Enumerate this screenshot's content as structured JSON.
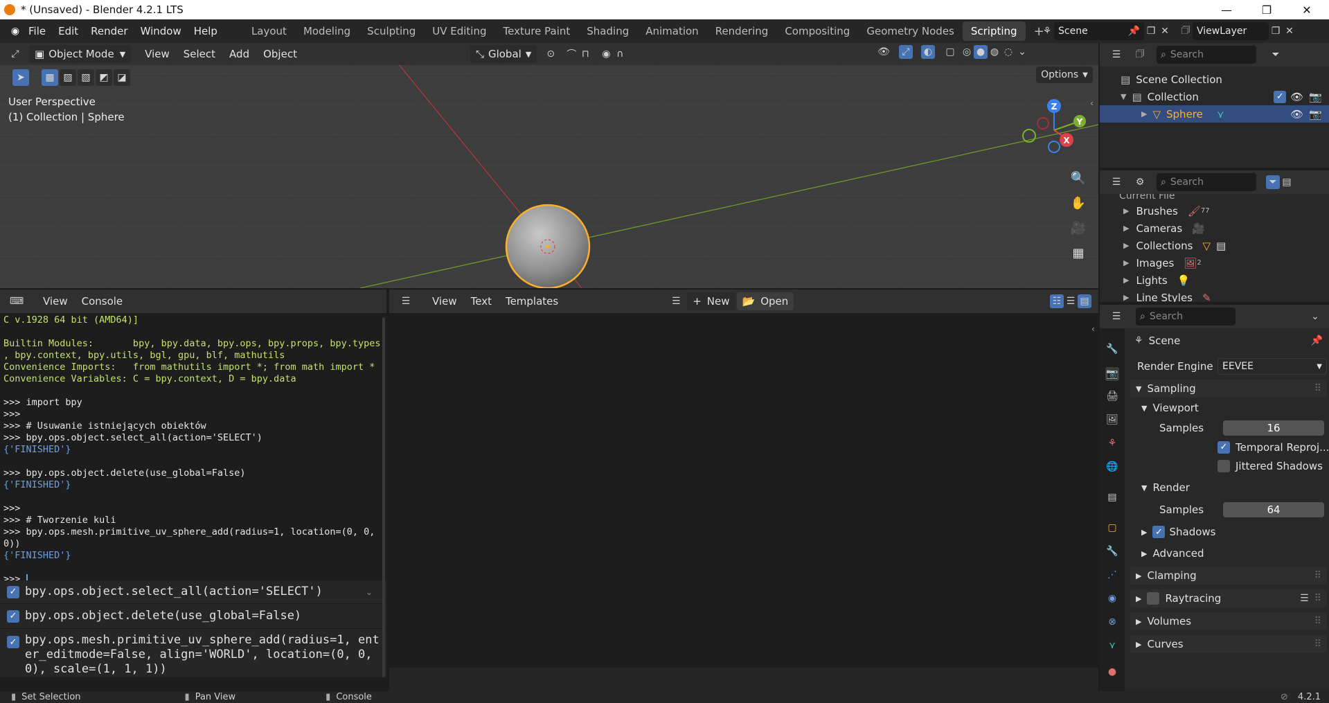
{
  "window": {
    "title": "* (Unsaved) - Blender 4.2.1 LTS"
  },
  "menus": [
    "File",
    "Edit",
    "Render",
    "Window",
    "Help"
  ],
  "workspaces": [
    "Layout",
    "Modeling",
    "Sculpting",
    "UV Editing",
    "Texture Paint",
    "Shading",
    "Animation",
    "Rendering",
    "Compositing",
    "Geometry Nodes",
    "Scripting"
  ],
  "active_workspace": "Scripting",
  "scene": {
    "name": "Scene",
    "view_layer": "ViewLayer"
  },
  "viewport": {
    "mode": "Object Mode",
    "menus": [
      "View",
      "Select",
      "Add",
      "Object"
    ],
    "transform_orientation": "Global",
    "options_label": "Options",
    "overlay_lines": [
      "User Perspective",
      "(1) Collection | Sphere"
    ],
    "gizmo": {
      "z": "Z",
      "y": "Y",
      "x": "X"
    }
  },
  "outliner": {
    "search_placeholder": "Search",
    "items": [
      "Scene Collection",
      "Collection",
      "Sphere"
    ]
  },
  "blend_browser": {
    "search_placeholder": "Search",
    "partial_header": "Current File",
    "items": [
      {
        "label": "Brushes",
        "count": "77"
      },
      {
        "label": "Cameras",
        "count": ""
      },
      {
        "label": "Collections",
        "count": ""
      },
      {
        "label": "Images",
        "count": "2"
      },
      {
        "label": "Lights",
        "count": ""
      },
      {
        "label": "Line Styles",
        "count": ""
      }
    ]
  },
  "console": {
    "menus": [
      "View",
      "Console"
    ],
    "lines": [
      {
        "t": "C v.1928 64 bit (AMD64)]",
        "c": "#c8e06a"
      },
      {
        "t": "",
        "c": "#c8e06a"
      },
      {
        "t": "Builtin Modules:       bpy, bpy.data, bpy.ops, bpy.props, bpy.types",
        "c": "#c8e06a"
      },
      {
        "t": ", bpy.context, bpy.utils, bgl, gpu, blf, mathutils",
        "c": "#c8e06a"
      },
      {
        "t": "Convenience Imports:   from mathutils import *; from math import *",
        "c": "#c8e06a"
      },
      {
        "t": "Convenience Variables: C = bpy.context, D = bpy.data",
        "c": "#c8e06a"
      },
      {
        "t": "",
        "c": "#e6e6e6"
      },
      {
        "t": ">>> import bpy",
        "c": "#e6e6e6"
      },
      {
        "t": ">>>",
        "c": "#e6e6e6"
      },
      {
        "t": ">>> # Usuwanie istniejących obiektów",
        "c": "#e6e6e6"
      },
      {
        "t": ">>> bpy.ops.object.select_all(action='SELECT')",
        "c": "#e6e6e6"
      },
      {
        "t": "{'FINISHED'}",
        "c": "#6d9fe0"
      },
      {
        "t": "",
        "c": "#e6e6e6"
      },
      {
        "t": ">>> bpy.ops.object.delete(use_global=False)",
        "c": "#e6e6e6"
      },
      {
        "t": "{'FINISHED'}",
        "c": "#6d9fe0"
      },
      {
        "t": "",
        "c": "#e6e6e6"
      },
      {
        "t": ">>>",
        "c": "#e6e6e6"
      },
      {
        "t": ">>> # Tworzenie kuli",
        "c": "#e6e6e6"
      },
      {
        "t": ">>> bpy.ops.mesh.primitive_uv_sphere_add(radius=1, location=(0, 0,",
        "c": "#e6e6e6"
      },
      {
        "t": "0))",
        "c": "#e6e6e6"
      },
      {
        "t": "{'FINISHED'}",
        "c": "#6d9fe0"
      },
      {
        "t": "",
        "c": "#e6e6e6"
      },
      {
        "t": ">>> ",
        "c": "#e6e6e6"
      }
    ]
  },
  "info_log": [
    "bpy.ops.object.select_all(action='SELECT')",
    "bpy.ops.object.delete(use_global=False)",
    "bpy.ops.mesh.primitive_uv_sphere_add(radius=1, enter_editmode=False, align='WORLD', location=(0, 0, 0), scale=(1, 1, 1))"
  ],
  "text_editor": {
    "menus": [
      "View",
      "Text",
      "Templates"
    ],
    "new_label": "New",
    "open_label": "Open"
  },
  "properties": {
    "search_placeholder": "Search",
    "context": "Scene",
    "render_engine_label": "Render Engine",
    "render_engine": "EEVEE",
    "sampling": "Sampling",
    "viewport": "Viewport",
    "samples_label": "Samples",
    "viewport_samples": "16",
    "temporal_reprojection": "Temporal Reproj...",
    "jittered_shadows": "Jittered Shadows",
    "render": "Render",
    "render_samples": "64",
    "shadows": "Shadows",
    "advanced": "Advanced",
    "clamping": "Clamping",
    "raytracing": "Raytracing",
    "volumes": "Volumes",
    "curves": "Curves"
  },
  "statusbar": {
    "left": "Set Selection",
    "middle": "Pan View",
    "right": "Console",
    "version": "4.2.1"
  },
  "colors": {
    "accent": "#4772b3",
    "selected_object": "#ffaf29",
    "x_axis": "#e0404a",
    "y_axis": "#7ab02c",
    "z_axis": "#3b82f0"
  }
}
